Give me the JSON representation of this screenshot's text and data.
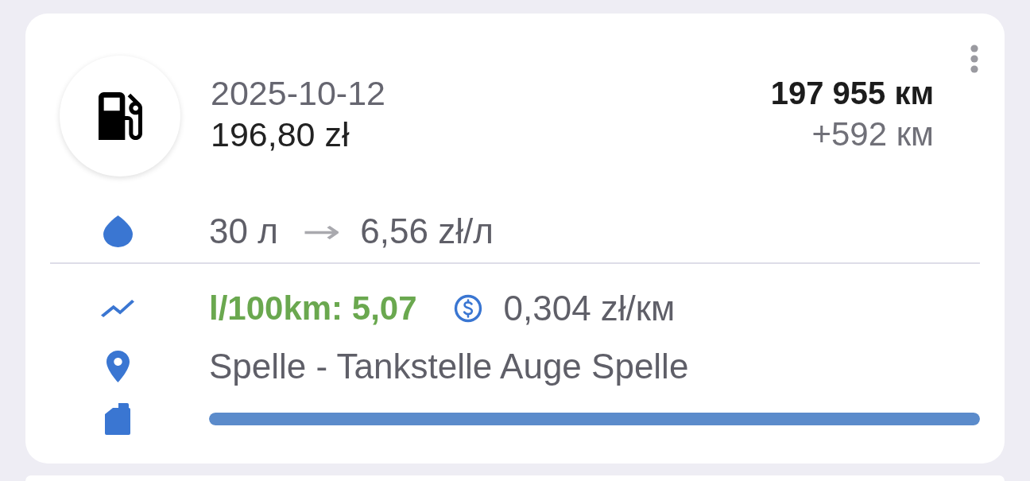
{
  "entry": {
    "date": "2025-10-12",
    "cost": "196,80 zł",
    "odometer": "197 955 км",
    "distance": "+592 км",
    "volume": "30 л",
    "arrow": "→",
    "unit_price": "6,56 zł/л",
    "consumption": "l/100km: 5,07",
    "cost_per_km": "0,304 zł/км",
    "location": "Spelle - Tankstelle Auge Spelle",
    "tank": {
      "level": 1
    }
  }
}
